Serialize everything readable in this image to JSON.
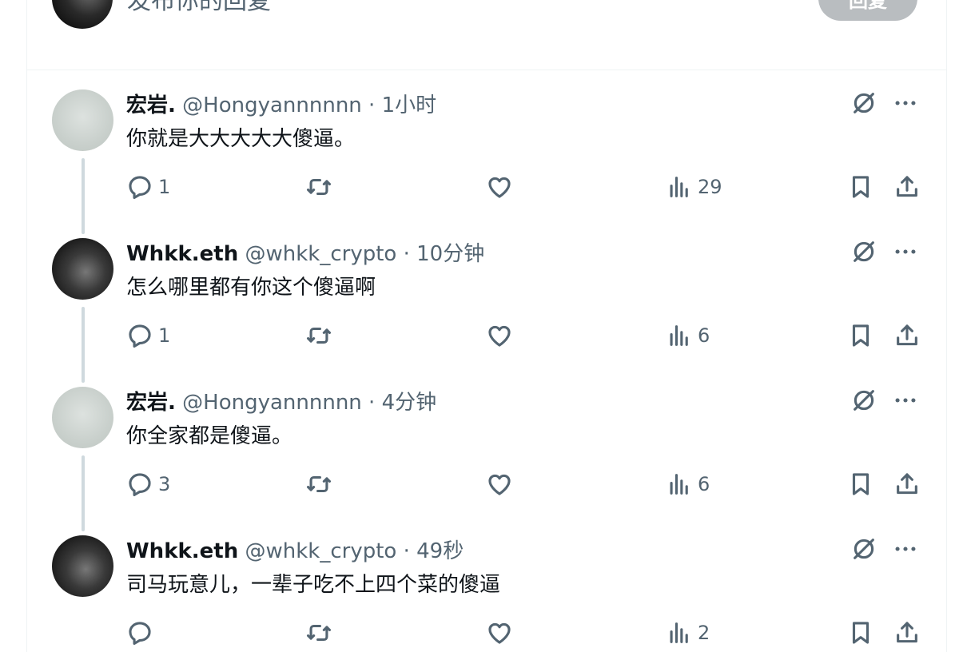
{
  "composer": {
    "placeholder": "发布你的回复",
    "reply_button": "回复"
  },
  "tweets": [
    {
      "name": "宏岩.",
      "handle": "@Hongyannnnnn",
      "time": "1小时",
      "text": "你就是大大大大大傻逼。",
      "replies": "1",
      "retweets": "",
      "likes": "",
      "views": "29",
      "avatar": "light"
    },
    {
      "name": "Whkk.eth",
      "handle": "@whkk_crypto",
      "time": "10分钟",
      "text": "怎么哪里都有你这个傻逼啊",
      "replies": "1",
      "retweets": "",
      "likes": "",
      "views": "6",
      "avatar": "dark"
    },
    {
      "name": "宏岩.",
      "handle": "@Hongyannnnnn",
      "time": "4分钟",
      "text": "你全家都是傻逼。",
      "replies": "3",
      "retweets": "",
      "likes": "",
      "views": "6",
      "avatar": "light"
    },
    {
      "name": "Whkk.eth",
      "handle": "@whkk_crypto",
      "time": "49秒",
      "text": "司马玩意儿，一辈子吃不上四个菜的傻逼",
      "replies": "",
      "retweets": "",
      "likes": "",
      "views": "2",
      "avatar": "dark"
    }
  ],
  "separator": " · ",
  "icons": {
    "reply": "reply-icon",
    "retweet": "retweet-icon",
    "like": "heart-icon",
    "views": "views-icon",
    "bookmark": "bookmark-icon",
    "share": "share-icon",
    "grok": "grok-icon",
    "more": "more-icon"
  }
}
